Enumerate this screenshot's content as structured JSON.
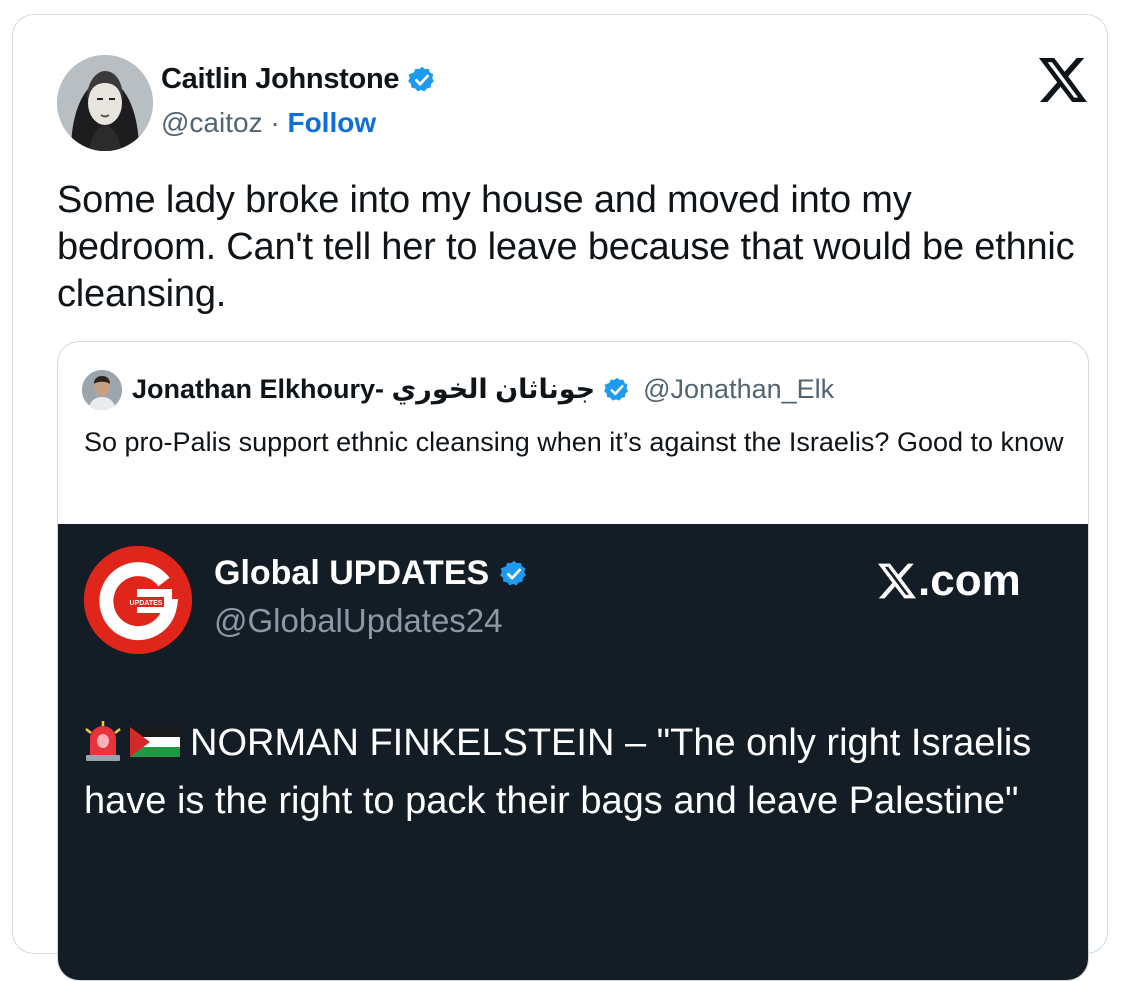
{
  "tweet": {
    "author": {
      "name": "Caitlin Johnstone",
      "handle": "@caitoz",
      "separator": "·",
      "follow_label": "Follow"
    },
    "text": "Some lady broke into my house and moved into my bedroom. Can't tell her to leave because that would be ethnic cleansing."
  },
  "quote": {
    "author": {
      "name": "Jonathan Elkhoury- جوناثان الخوري",
      "handle": "@Jonathan_Elk"
    },
    "text": "So pro-Palis support ethnic cleansing when it’s against the Israelis? Good to know",
    "media": {
      "name": "Global UPDATES",
      "handle": "@GlobalUpdates24",
      "brand": ".com",
      "logo_small_text": "UPDATES",
      "text": "NORMAN FINKELSTEIN – \"The only right Israelis have is the right to pack their bags and leave Palestine\""
    }
  },
  "colors": {
    "verified": "#1d9bf0",
    "follow": "#0f6fd6",
    "media_bg": "#141d26",
    "logo_red": "#e0251b"
  },
  "icons": {
    "verified": "verified-badge-icon",
    "x_logo": "x-logo-icon",
    "siren": "siren-emoji",
    "flag": "palestine-flag-emoji"
  }
}
